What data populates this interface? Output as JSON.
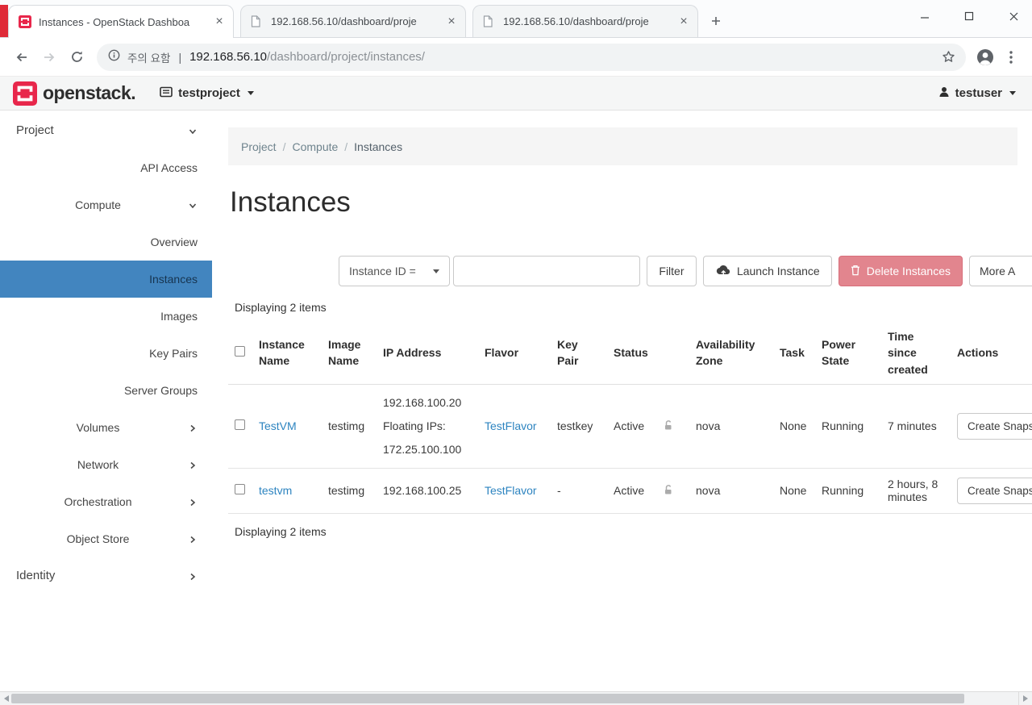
{
  "browser": {
    "tabs": [
      {
        "title": "Instances - OpenStack Dashboa"
      },
      {
        "title": "192.168.56.10/dashboard/proje"
      },
      {
        "title": "192.168.56.10/dashboard/proje"
      }
    ],
    "address": {
      "security_text": "주의 요함",
      "separator": "|",
      "host": "192.168.56.10",
      "path": "/dashboard/project/instances/"
    }
  },
  "header": {
    "logo_text": "openstack.",
    "project_selector": "testproject",
    "user_name": "testuser"
  },
  "sidebar": {
    "items": [
      {
        "label": "Project"
      },
      {
        "label": "API Access"
      },
      {
        "label": "Compute"
      },
      {
        "label": "Overview"
      },
      {
        "label": "Instances"
      },
      {
        "label": "Images"
      },
      {
        "label": "Key Pairs"
      },
      {
        "label": "Server Groups"
      },
      {
        "label": "Volumes"
      },
      {
        "label": "Network"
      },
      {
        "label": "Orchestration"
      },
      {
        "label": "Object Store"
      },
      {
        "label": "Identity"
      }
    ]
  },
  "main": {
    "breadcrumb": {
      "items": [
        "Project",
        "Compute",
        "Instances"
      ],
      "separator": "/"
    },
    "page_title": "Instances",
    "toolbar": {
      "filter_dropdown_label": "Instance ID =",
      "filter_button_label": "Filter",
      "launch_button_label": "Launch Instance",
      "delete_button_label": "Delete Instances",
      "more_button_label": "More A"
    },
    "count_top": "Displaying 2 items",
    "count_bottom": "Displaying 2 items",
    "table": {
      "headers": {
        "instance_name": "Instance Name",
        "image_name": "Image Name",
        "ip_address": "IP Address",
        "flavor": "Flavor",
        "key_pair": "Key Pair",
        "status": "Status",
        "availability_zone": "Availability Zone",
        "task": "Task",
        "power_state": "Power State",
        "time_since_created": "Time since created",
        "actions": "Actions"
      },
      "rows": [
        {
          "instance_name": "TestVM",
          "image_name": "testimg",
          "ip_line1": "192.168.100.20",
          "ip_line2": "Floating IPs:",
          "ip_line3": "172.25.100.100",
          "flavor": "TestFlavor",
          "key_pair": "testkey",
          "status": "Active",
          "availability_zone": "nova",
          "task": "None",
          "power_state": "Running",
          "time_since_created": "7 minutes",
          "action_label": "Create Snaps"
        },
        {
          "instance_name": "testvm",
          "image_name": "testimg",
          "ip_line1": "192.168.100.25",
          "flavor": "TestFlavor",
          "key_pair": "-",
          "status": "Active",
          "availability_zone": "nova",
          "task": "None",
          "power_state": "Running",
          "time_since_created": "2 hours, 8 minutes",
          "action_label": "Create Snaps"
        }
      ]
    }
  },
  "colors": {
    "brand_red": "#e8274b",
    "sidebar_active_bg": "#4285bf",
    "link_blue": "#2d84c0",
    "danger_button_bg": "#e2858e",
    "breadcrumb_bg": "#f5f5f5"
  }
}
